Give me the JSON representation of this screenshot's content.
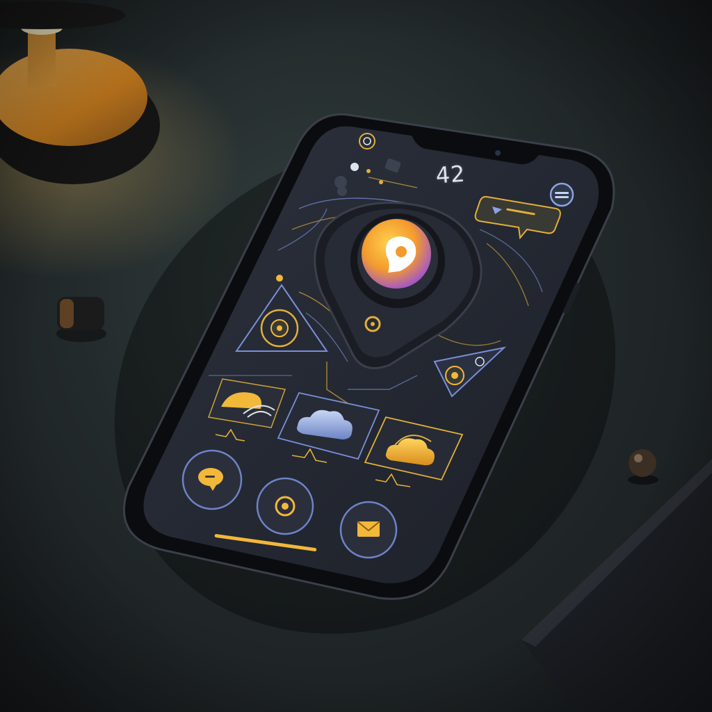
{
  "status_bar": {
    "counter": "42"
  },
  "colors": {
    "accent_gold": "#f2b83a",
    "accent_orange": "#f08f2a",
    "accent_purple": "#9b5de5",
    "screen_bg": "#262b35",
    "line_blue": "#7a8fd8",
    "desk_bg": "#232a2b"
  },
  "icons": {
    "hero": "location-pin-icon",
    "chat": "chat-bubble-icon",
    "target": "target-icon",
    "mail": "envelope-icon",
    "cloud": "cloud-icon",
    "menu": "menu-icon",
    "spiral": "spiral-icon",
    "message": "message-bubble-icon"
  }
}
